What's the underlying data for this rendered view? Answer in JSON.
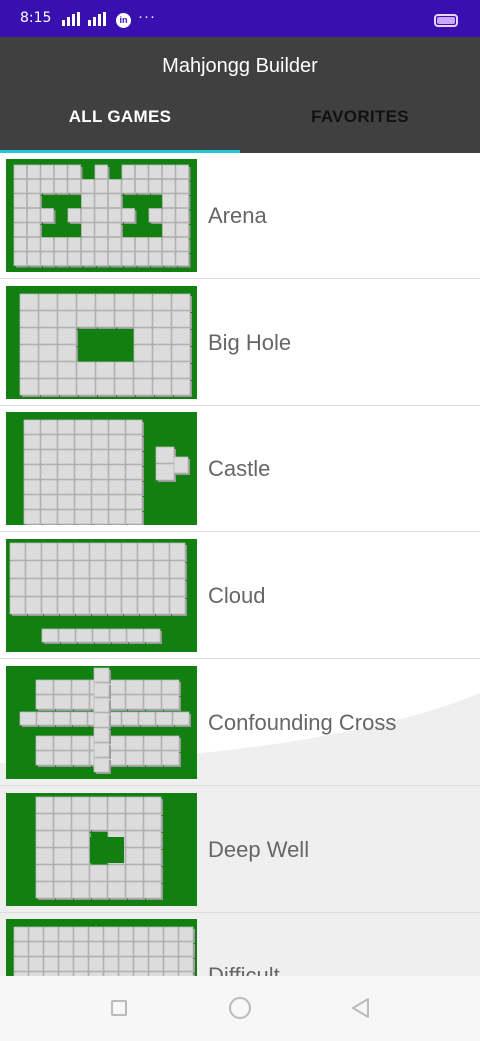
{
  "status_bar": {
    "time": "8:15",
    "dots": "···",
    "linkedin": "in"
  },
  "app_bar": {
    "title": "Mahjongg Builder"
  },
  "tabs": [
    {
      "label": "ALL GAMES",
      "selected": true
    },
    {
      "label": "FAVORITES",
      "selected": false
    }
  ],
  "colors": {
    "accent": "#26c6da",
    "status_bar": "#3a0fb0",
    "app_bar": "#404040",
    "board_green": "#118011"
  },
  "games": [
    {
      "name": "Arena",
      "preview": "arena"
    },
    {
      "name": "Big Hole",
      "preview": "big-hole"
    },
    {
      "name": "Castle",
      "preview": "castle"
    },
    {
      "name": "Cloud",
      "preview": "cloud"
    },
    {
      "name": "Confounding Cross",
      "preview": "cross"
    },
    {
      "name": "Deep Well",
      "preview": "deep-well"
    },
    {
      "name": "Difficult",
      "preview": "difficult"
    }
  ],
  "nav": {
    "recents_icon": "square-icon",
    "home_icon": "circle-icon",
    "back_icon": "triangle-back-icon"
  }
}
